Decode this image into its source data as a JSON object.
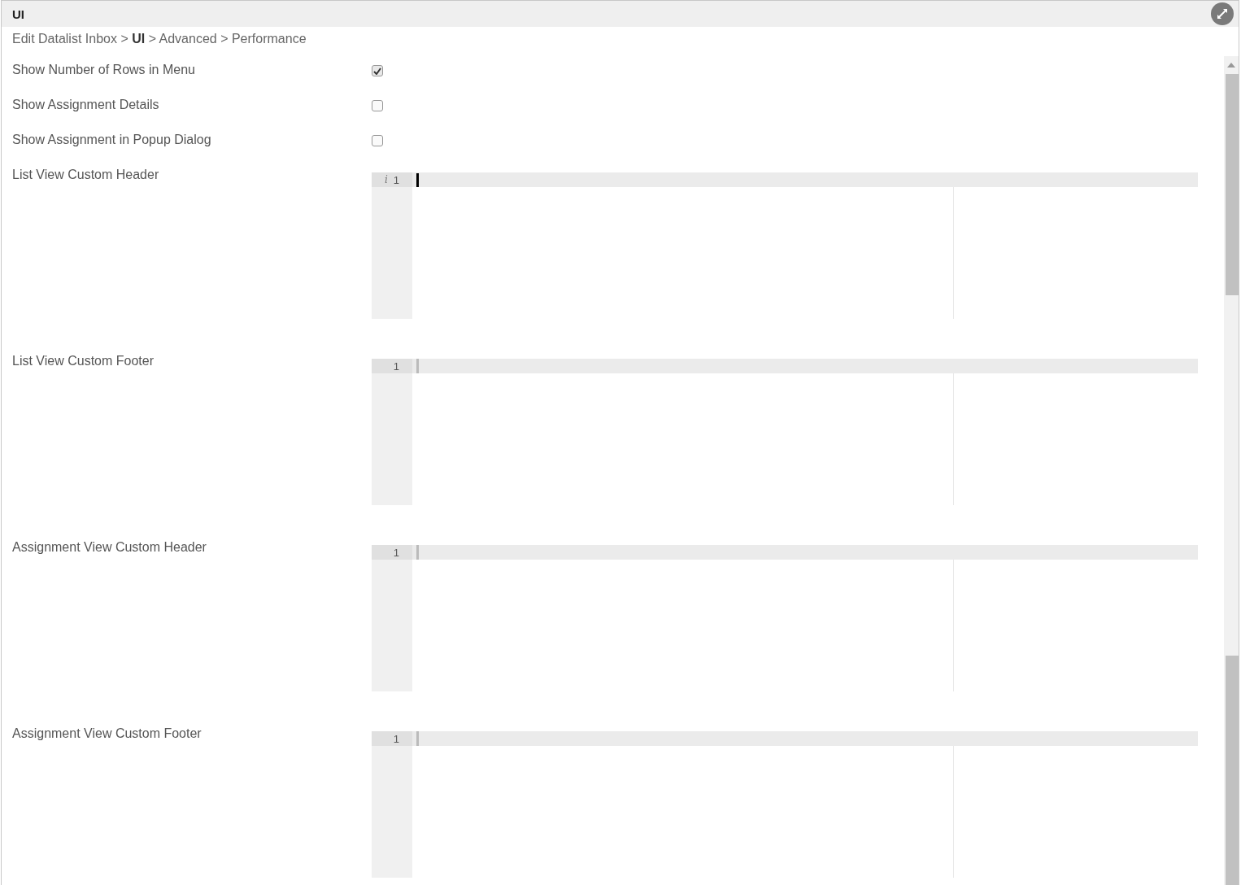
{
  "panel": {
    "title": "UI"
  },
  "breadcrumb": "Edit Datalist Inbox > **UI** > Advanced > Performance",
  "checkboxes": [
    {
      "label": "Show Number of Rows in Menu",
      "checked": true
    },
    {
      "label": "Show Assignment Details",
      "checked": false
    },
    {
      "label": "Show Assignment in Popup Dialog",
      "checked": false
    }
  ],
  "editors": [
    {
      "label": "List View Custom Header",
      "line_number": "1",
      "marker": "i",
      "focused": true
    },
    {
      "label": "List View Custom Footer",
      "line_number": "1",
      "focused": false
    },
    {
      "label": "Assignment View Custom Header",
      "line_number": "1",
      "focused": false
    },
    {
      "label": "Assignment View Custom Footer",
      "line_number": "1",
      "focused": false
    }
  ]
}
